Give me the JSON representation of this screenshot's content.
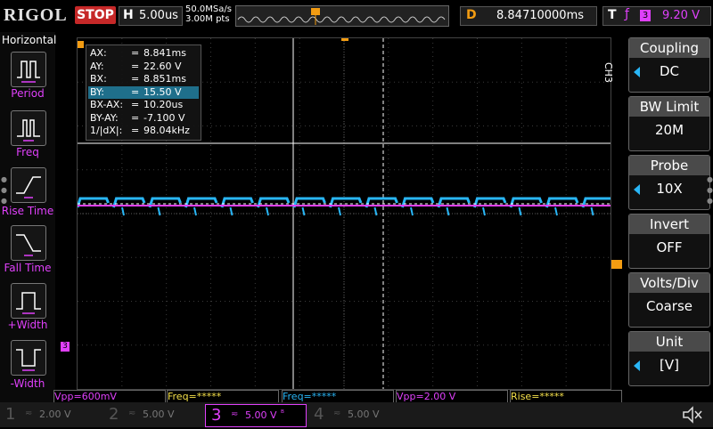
{
  "brand": "RIGOL",
  "run_state": "STOP",
  "timebase": {
    "key": "H",
    "value": "5.00us"
  },
  "acquisition": {
    "sample_rate": "50.0MSa/s",
    "memory_depth": "3.00M pts"
  },
  "delay": {
    "key": "D",
    "value": "8.84710000ms"
  },
  "trigger": {
    "key": "T",
    "edge_icon": "rising-edge-icon",
    "source": "3",
    "level": "9.20 V"
  },
  "left_menu": {
    "title": "Horizontal",
    "items": [
      {
        "label": "Period",
        "icon": "period-icon"
      },
      {
        "label": "Freq",
        "icon": "freq-icon"
      },
      {
        "label": "Rise Time",
        "icon": "rise-time-icon"
      },
      {
        "label": "Fall Time",
        "icon": "fall-time-icon"
      },
      {
        "label": "+Width",
        "icon": "pos-width-icon"
      },
      {
        "label": "-Width",
        "icon": "neg-width-icon"
      }
    ]
  },
  "cursors": [
    {
      "name": "AX:",
      "eq": "=",
      "value": "8.841ms"
    },
    {
      "name": "AY:",
      "eq": "=",
      "value": "22.60 V"
    },
    {
      "name": "BX:",
      "eq": "=",
      "value": "8.851ms"
    },
    {
      "name": "BY:",
      "eq": "=",
      "value": "15.50 V"
    },
    {
      "name": "BX-AX:",
      "eq": "=",
      "value": "10.20us"
    },
    {
      "name": "BY-AY:",
      "eq": "=",
      "value": "-7.100 V"
    },
    {
      "name": "1/|dX|:",
      "eq": "=",
      "value": "98.04kHz"
    }
  ],
  "channel_marker": "3",
  "right_menu": {
    "channel": "CH3",
    "items": [
      {
        "title": "Coupling",
        "value": "DC",
        "arrow": true
      },
      {
        "title": "BW Limit",
        "value": "20M",
        "arrow": false
      },
      {
        "title": "Probe",
        "value": "10X",
        "arrow": true
      },
      {
        "title": "Invert",
        "value": "OFF",
        "arrow": false
      },
      {
        "title": "Volts/Div",
        "value": "Coarse",
        "arrow": false
      },
      {
        "title": "Unit",
        "value": "[V]",
        "arrow": true
      }
    ]
  },
  "measurements": [
    {
      "text": "Vpp=600mV",
      "color": "#e040fb"
    },
    {
      "text": "Freq=*****",
      "color": "#f5e04a"
    },
    {
      "text": "Freq=*****",
      "color": "#29b6f6"
    },
    {
      "text": "Vpp=2.00 V",
      "color": "#e040fb"
    },
    {
      "text": "Rise=*****",
      "color": "#f5e04a"
    }
  ],
  "channels": [
    {
      "num": "1",
      "scale": "2.00 V",
      "color": "#f5e04a",
      "active": false
    },
    {
      "num": "2",
      "scale": "5.00 V",
      "color": "#26c6da",
      "active": false
    },
    {
      "num": "3",
      "scale": "5.00 V",
      "color": "#e040fb",
      "active": true
    },
    {
      "num": "4",
      "scale": "5.00 V",
      "color": "#29b6f6",
      "active": false
    }
  ],
  "colors": {
    "ch1": "#f5e04a",
    "ch2": "#26c6da",
    "ch3": "#e040fb",
    "ch4": "#29b6f6",
    "cursor": "#ffffff",
    "trigger": "#f39c12"
  },
  "mute_icon": "speaker-mute-icon"
}
